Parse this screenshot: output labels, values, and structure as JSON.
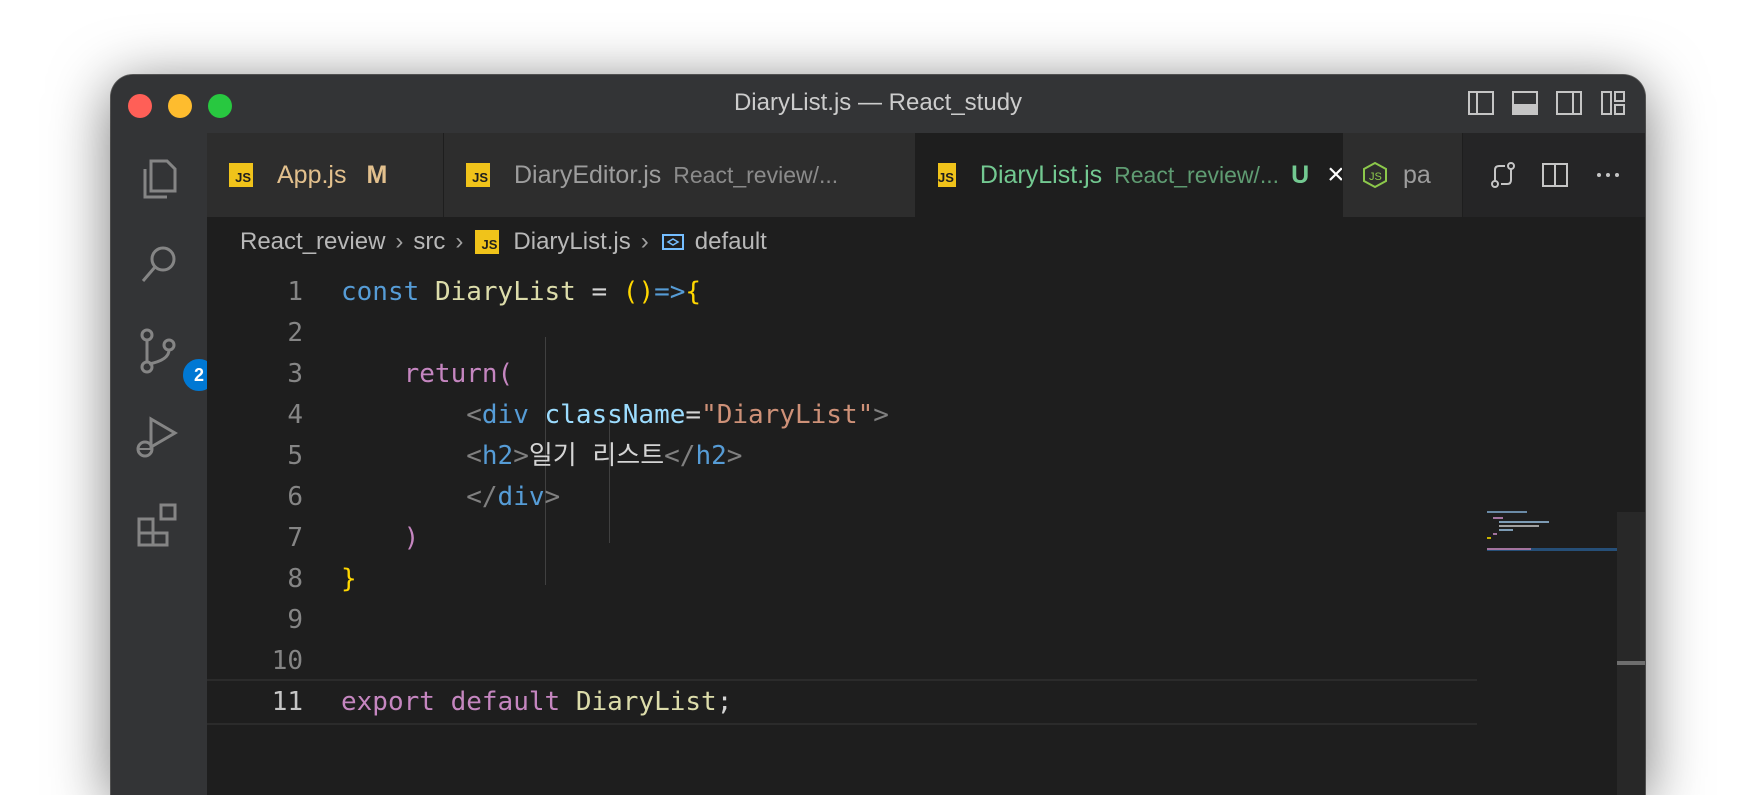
{
  "window": {
    "title": "DiaryList.js — React_study"
  },
  "activity_bar": {
    "source_control_badge": "2"
  },
  "tabs": [
    {
      "name": "App.js",
      "mark": "M",
      "active": false
    },
    {
      "name": "DiaryEditor.js",
      "desc": "React_review/...",
      "active": false
    },
    {
      "name": "DiaryList.js",
      "desc": "React_review/...",
      "mark": "U",
      "active": true
    },
    {
      "name": "pa",
      "active": false
    }
  ],
  "tab_icons": {
    "js": "JS"
  },
  "breadcrumb": {
    "items": [
      "React_review",
      "src",
      "DiaryList.js",
      "default"
    ]
  },
  "editor": {
    "line_numbers": [
      "1",
      "2",
      "3",
      "4",
      "5",
      "6",
      "7",
      "8",
      "9",
      "10",
      "11"
    ],
    "lines": [
      [
        [
          "const",
          "k-blue"
        ],
        [
          " ",
          ""
        ],
        [
          "DiaryList",
          "k-fn"
        ],
        [
          " = ",
          ""
        ],
        [
          "()",
          "k-gold"
        ],
        [
          "=>",
          "k-arrow"
        ],
        [
          "{",
          "k-gold"
        ]
      ],
      [],
      [
        [
          "    ",
          ""
        ],
        [
          "return",
          "k-pur"
        ],
        [
          "(",
          "k-pur"
        ]
      ],
      [
        [
          "        ",
          ""
        ],
        [
          "<",
          "k-tag"
        ],
        [
          "div",
          "k-blue"
        ],
        [
          " ",
          ""
        ],
        [
          "className",
          "k-var"
        ],
        [
          "=",
          ""
        ],
        [
          "\"DiaryList\"",
          "k-str"
        ],
        [
          ">",
          "k-tag"
        ]
      ],
      [
        [
          "        ",
          ""
        ],
        [
          "<",
          "k-tag"
        ],
        [
          "h2",
          "k-blue"
        ],
        [
          ">",
          "k-tag"
        ],
        [
          "일기 리스트",
          "k-txt"
        ],
        [
          "</",
          "k-tag"
        ],
        [
          "h2",
          "k-blue"
        ],
        [
          ">",
          "k-tag"
        ]
      ],
      [
        [
          "        ",
          ""
        ],
        [
          "</",
          "k-tag"
        ],
        [
          "div",
          "k-blue"
        ],
        [
          ">",
          "k-tag"
        ]
      ],
      [
        [
          "    ",
          ""
        ],
        [
          ")",
          "k-pur"
        ]
      ],
      [
        [
          "}",
          "k-gold"
        ]
      ],
      [],
      [],
      [
        [
          "export",
          "k-pur"
        ],
        [
          " ",
          ""
        ],
        [
          "default",
          "k-pur"
        ],
        [
          " ",
          ""
        ],
        [
          "DiaryList",
          "k-fn"
        ],
        [
          ";",
          ""
        ]
      ]
    ]
  },
  "colors": {
    "editor_bg": "#1e1e1e",
    "activity_bg": "#333436",
    "active_tab_fg": "#73c991",
    "badge_bg": "#0078d4"
  }
}
